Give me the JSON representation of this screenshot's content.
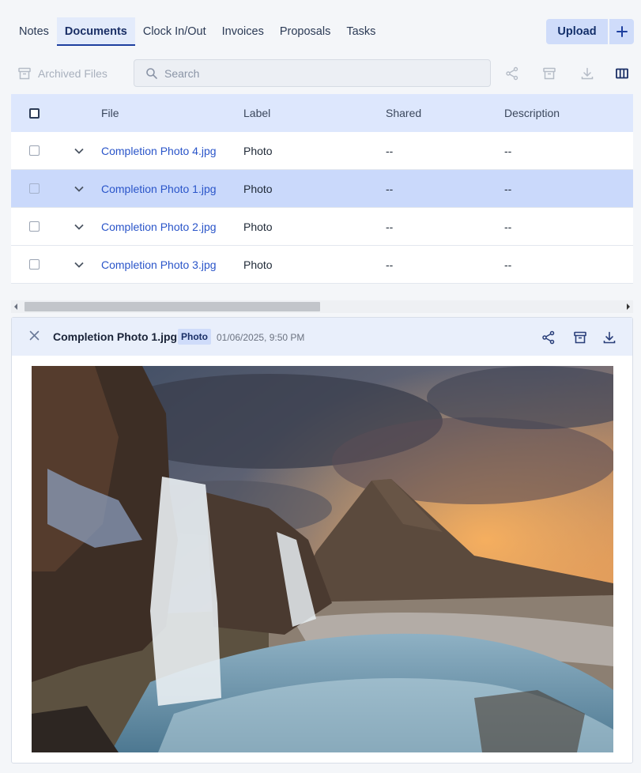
{
  "tabs": [
    {
      "label": "Notes"
    },
    {
      "label": "Documents"
    },
    {
      "label": "Clock In/Out"
    },
    {
      "label": "Invoices"
    },
    {
      "label": "Proposals"
    },
    {
      "label": "Tasks"
    }
  ],
  "active_tab": "Documents",
  "upload": {
    "label": "Upload"
  },
  "toolbar": {
    "archived_label": "Archived Files",
    "search_placeholder": "Search"
  },
  "table": {
    "columns": [
      "File",
      "Label",
      "Shared",
      "Description"
    ],
    "rows": [
      {
        "file": "Completion Photo 4.jpg",
        "label": "Photo",
        "shared": "--",
        "description": "--"
      },
      {
        "file": "Completion Photo 1.jpg",
        "label": "Photo",
        "shared": "--",
        "description": "--"
      },
      {
        "file": "Completion Photo 2.jpg",
        "label": "Photo",
        "shared": "--",
        "description": "--"
      },
      {
        "file": "Completion Photo 3.jpg",
        "label": "Photo",
        "shared": "--",
        "description": "--"
      }
    ],
    "selected_row": 1
  },
  "preview": {
    "title": "Completion Photo 1.jpg",
    "badge": "Photo",
    "date": "01/06/2025, 9:50 PM"
  },
  "colors": {
    "accent": "#1d3f9f",
    "link": "#2a55c9",
    "header_bg": "#dde7fd",
    "selected_row": "#cad9fb"
  }
}
